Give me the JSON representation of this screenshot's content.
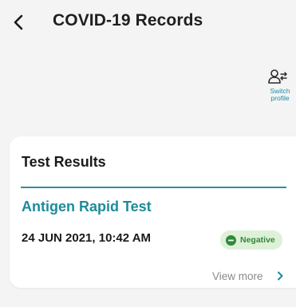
{
  "header": {
    "title": "COVID-19 Records",
    "back_icon": "chevron-left-icon"
  },
  "switch_profile": {
    "label_line1": "Switch",
    "label_line2": "profile",
    "icon": "switch-profile-icon"
  },
  "test_results": {
    "heading": "Test Results",
    "items": [
      {
        "name": "Antigen Rapid Test",
        "date": "24 JUN 2021, 10:42 AM",
        "status": "Negative",
        "view_more": "View more"
      }
    ]
  },
  "colors": {
    "accent": "#1d8b9b",
    "divider": "#2e8fa0",
    "status_bg": "#dff0d8",
    "status_text": "#2f8a3a",
    "status_dot": "#2f8a3a",
    "background": "#f4f4f4"
  }
}
